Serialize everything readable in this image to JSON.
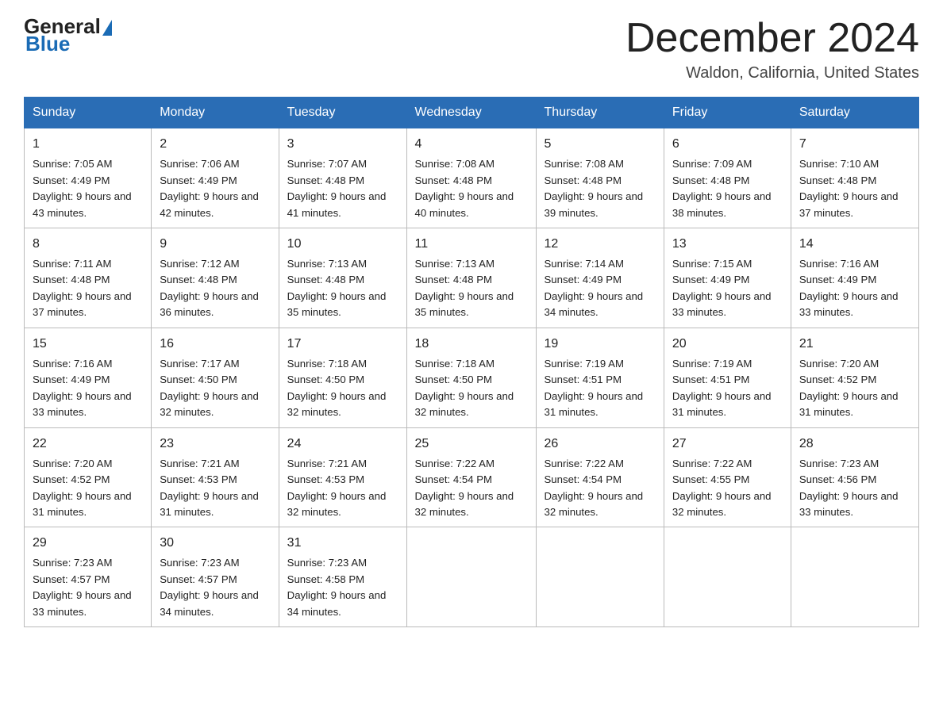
{
  "header": {
    "month_year": "December 2024",
    "location": "Waldon, California, United States",
    "logo_general": "General",
    "logo_blue": "Blue"
  },
  "days_of_week": [
    "Sunday",
    "Monday",
    "Tuesday",
    "Wednesday",
    "Thursday",
    "Friday",
    "Saturday"
  ],
  "weeks": [
    [
      {
        "day": "1",
        "sunrise": "7:05 AM",
        "sunset": "4:49 PM",
        "daylight": "9 hours and 43 minutes."
      },
      {
        "day": "2",
        "sunrise": "7:06 AM",
        "sunset": "4:49 PM",
        "daylight": "9 hours and 42 minutes."
      },
      {
        "day": "3",
        "sunrise": "7:07 AM",
        "sunset": "4:48 PM",
        "daylight": "9 hours and 41 minutes."
      },
      {
        "day": "4",
        "sunrise": "7:08 AM",
        "sunset": "4:48 PM",
        "daylight": "9 hours and 40 minutes."
      },
      {
        "day": "5",
        "sunrise": "7:08 AM",
        "sunset": "4:48 PM",
        "daylight": "9 hours and 39 minutes."
      },
      {
        "day": "6",
        "sunrise": "7:09 AM",
        "sunset": "4:48 PM",
        "daylight": "9 hours and 38 minutes."
      },
      {
        "day": "7",
        "sunrise": "7:10 AM",
        "sunset": "4:48 PM",
        "daylight": "9 hours and 37 minutes."
      }
    ],
    [
      {
        "day": "8",
        "sunrise": "7:11 AM",
        "sunset": "4:48 PM",
        "daylight": "9 hours and 37 minutes."
      },
      {
        "day": "9",
        "sunrise": "7:12 AM",
        "sunset": "4:48 PM",
        "daylight": "9 hours and 36 minutes."
      },
      {
        "day": "10",
        "sunrise": "7:13 AM",
        "sunset": "4:48 PM",
        "daylight": "9 hours and 35 minutes."
      },
      {
        "day": "11",
        "sunrise": "7:13 AM",
        "sunset": "4:48 PM",
        "daylight": "9 hours and 35 minutes."
      },
      {
        "day": "12",
        "sunrise": "7:14 AM",
        "sunset": "4:49 PM",
        "daylight": "9 hours and 34 minutes."
      },
      {
        "day": "13",
        "sunrise": "7:15 AM",
        "sunset": "4:49 PM",
        "daylight": "9 hours and 33 minutes."
      },
      {
        "day": "14",
        "sunrise": "7:16 AM",
        "sunset": "4:49 PM",
        "daylight": "9 hours and 33 minutes."
      }
    ],
    [
      {
        "day": "15",
        "sunrise": "7:16 AM",
        "sunset": "4:49 PM",
        "daylight": "9 hours and 33 minutes."
      },
      {
        "day": "16",
        "sunrise": "7:17 AM",
        "sunset": "4:50 PM",
        "daylight": "9 hours and 32 minutes."
      },
      {
        "day": "17",
        "sunrise": "7:18 AM",
        "sunset": "4:50 PM",
        "daylight": "9 hours and 32 minutes."
      },
      {
        "day": "18",
        "sunrise": "7:18 AM",
        "sunset": "4:50 PM",
        "daylight": "9 hours and 32 minutes."
      },
      {
        "day": "19",
        "sunrise": "7:19 AM",
        "sunset": "4:51 PM",
        "daylight": "9 hours and 31 minutes."
      },
      {
        "day": "20",
        "sunrise": "7:19 AM",
        "sunset": "4:51 PM",
        "daylight": "9 hours and 31 minutes."
      },
      {
        "day": "21",
        "sunrise": "7:20 AM",
        "sunset": "4:52 PM",
        "daylight": "9 hours and 31 minutes."
      }
    ],
    [
      {
        "day": "22",
        "sunrise": "7:20 AM",
        "sunset": "4:52 PM",
        "daylight": "9 hours and 31 minutes."
      },
      {
        "day": "23",
        "sunrise": "7:21 AM",
        "sunset": "4:53 PM",
        "daylight": "9 hours and 31 minutes."
      },
      {
        "day": "24",
        "sunrise": "7:21 AM",
        "sunset": "4:53 PM",
        "daylight": "9 hours and 32 minutes."
      },
      {
        "day": "25",
        "sunrise": "7:22 AM",
        "sunset": "4:54 PM",
        "daylight": "9 hours and 32 minutes."
      },
      {
        "day": "26",
        "sunrise": "7:22 AM",
        "sunset": "4:54 PM",
        "daylight": "9 hours and 32 minutes."
      },
      {
        "day": "27",
        "sunrise": "7:22 AM",
        "sunset": "4:55 PM",
        "daylight": "9 hours and 32 minutes."
      },
      {
        "day": "28",
        "sunrise": "7:23 AM",
        "sunset": "4:56 PM",
        "daylight": "9 hours and 33 minutes."
      }
    ],
    [
      {
        "day": "29",
        "sunrise": "7:23 AM",
        "sunset": "4:57 PM",
        "daylight": "9 hours and 33 minutes."
      },
      {
        "day": "30",
        "sunrise": "7:23 AM",
        "sunset": "4:57 PM",
        "daylight": "9 hours and 34 minutes."
      },
      {
        "day": "31",
        "sunrise": "7:23 AM",
        "sunset": "4:58 PM",
        "daylight": "9 hours and 34 minutes."
      },
      null,
      null,
      null,
      null
    ]
  ],
  "colors": {
    "header_bg": "#2a6db5",
    "header_text": "#ffffff",
    "accent_blue": "#1a6bb5"
  }
}
